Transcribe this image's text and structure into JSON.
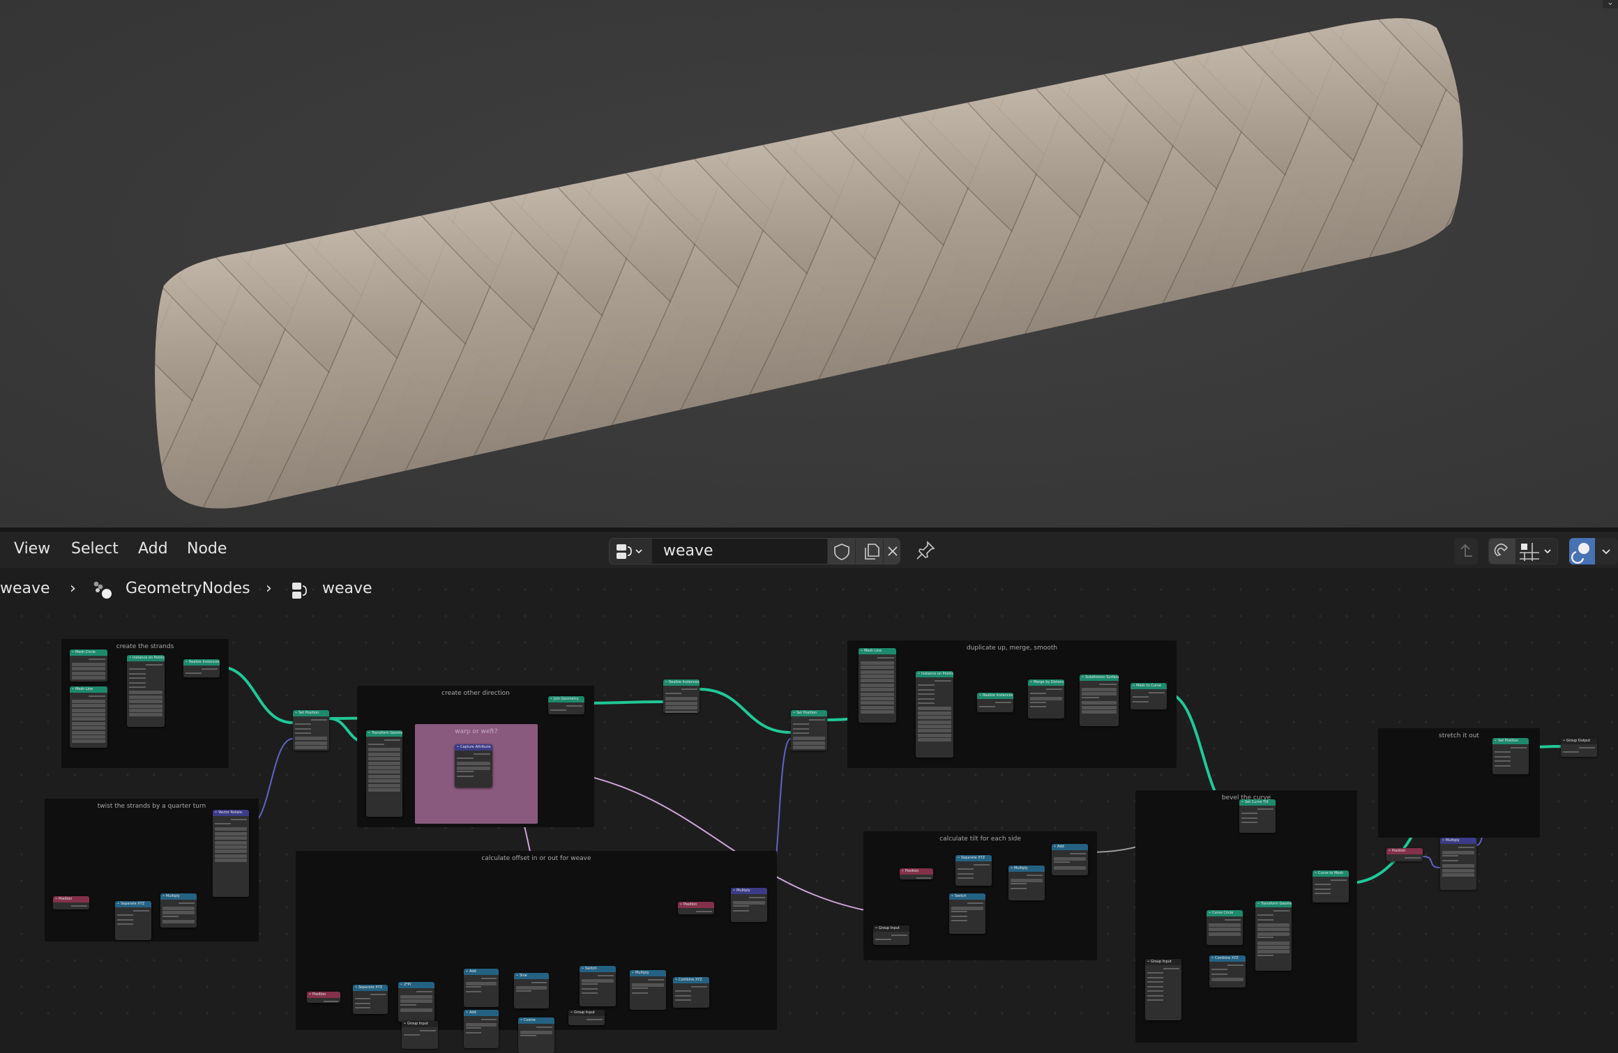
{
  "viewport": {
    "object": "woven braided tube",
    "colors": {
      "background": "#3a3a3a",
      "strand": "#a79b8d",
      "strand_highlight": "#d6cbbd",
      "strand_edge": "#3c3129"
    },
    "corner_icon": "chevron-down-icon"
  },
  "header": {
    "menus": [
      "View",
      "Select",
      "Add",
      "Node"
    ],
    "node_tree": {
      "type_icon": "geometry-node-tree-icon",
      "name": "weave",
      "fake_user_icon": "shield-icon",
      "duplicate_icon": "duplicate-icon",
      "unlink_icon": "close-icon"
    },
    "pin_icon": "pin-icon",
    "right_tools": {
      "parent_icon": "arrow-up-parent-icon",
      "snap_icon": "magnet-snap-icon",
      "snap_mode_icon": "grid-snap-icon",
      "overlay_icon": "overlay-icon",
      "accent": "#4772b3"
    }
  },
  "breadcrumb": {
    "items": [
      {
        "label": "weave",
        "icon": ""
      },
      {
        "label": "GeometryNodes",
        "icon": "modifier-nodes-icon"
      },
      {
        "label": "weave",
        "icon": "geometry-node-tree-icon"
      }
    ],
    "separator": "›"
  },
  "editor": {
    "colors": {
      "geometry_link": "#20c997",
      "vector_link": "#6363c7",
      "float_link": "#a1a1a1",
      "boolean_link": "#cca6d6",
      "geometry_header": "#1d8a6c",
      "vector_header": "#3c3b87",
      "converter_header": "#246283",
      "input_header": "#83314a",
      "group_header": "#222222"
    },
    "frames": [
      {
        "label": "create the strands"
      },
      {
        "label": "twist the strands by a quarter turn"
      },
      {
        "label": "create other direction"
      },
      {
        "label": "warp or weft?"
      },
      {
        "label": "calculate offset in or out for weave"
      },
      {
        "label": "duplicate up, merge, smooth"
      },
      {
        "label": "calculate tilt for each side"
      },
      {
        "label": "bevel the curve"
      },
      {
        "label": "stretch it out"
      }
    ],
    "nodes": [
      {
        "title": "Mesh Circle"
      },
      {
        "title": "Mesh Line"
      },
      {
        "title": "Instance on Points"
      },
      {
        "title": "Realize Instances"
      },
      {
        "title": "Set Position"
      },
      {
        "title": "Vector Rotate"
      },
      {
        "title": "Position"
      },
      {
        "title": "Separate XYZ"
      },
      {
        "title": "Multiply"
      },
      {
        "title": "Transform Geometry"
      },
      {
        "title": "Capture Attribute"
      },
      {
        "title": "Join Geometry"
      },
      {
        "title": "Realize Instances"
      },
      {
        "title": "Set Position"
      },
      {
        "title": "Position"
      },
      {
        "title": "Separate XYZ"
      },
      {
        "title": "2*Pi"
      },
      {
        "title": "Group Input"
      },
      {
        "title": "Add"
      },
      {
        "title": "Add"
      },
      {
        "title": "Sine"
      },
      {
        "title": "Cosine"
      },
      {
        "title": "Switch"
      },
      {
        "title": "Group Input"
      },
      {
        "title": "Multiply"
      },
      {
        "title": "Combine XYZ"
      },
      {
        "title": "Position"
      },
      {
        "title": "Multiply"
      },
      {
        "title": "Mesh Line"
      },
      {
        "title": "Instance on Points"
      },
      {
        "title": "Realize Instances"
      },
      {
        "title": "Merge by Distance"
      },
      {
        "title": "Subdivision Surface"
      },
      {
        "title": "Mesh to Curve"
      },
      {
        "title": "Position"
      },
      {
        "title": "Separate XYZ"
      },
      {
        "title": "Switch"
      },
      {
        "title": "Group Input"
      },
      {
        "title": "Multiply"
      },
      {
        "title": "Add"
      },
      {
        "title": "Set Curve Tilt"
      },
      {
        "title": "Curve Circle"
      },
      {
        "title": "Transform Geometry"
      },
      {
        "title": "Combine XYZ"
      },
      {
        "title": "Group Input"
      },
      {
        "title": "Curve to Mesh"
      },
      {
        "title": "Position"
      },
      {
        "title": "Multiply"
      },
      {
        "title": "Set Position"
      },
      {
        "title": "Group Output"
      }
    ]
  }
}
